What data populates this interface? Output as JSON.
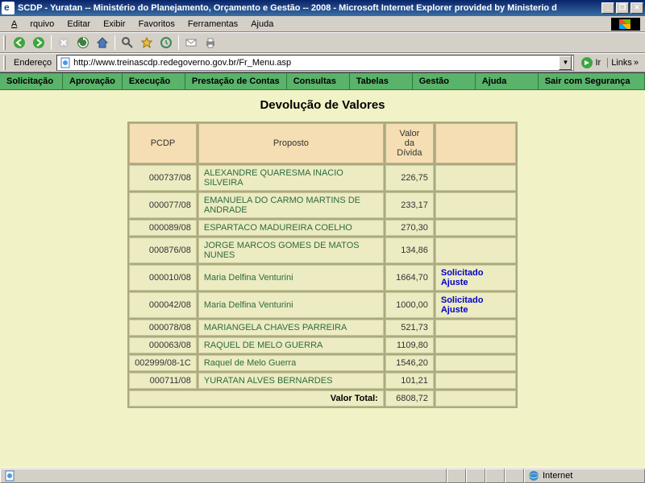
{
  "window": {
    "title": "SCDP - Yuratan -- Ministério do Planejamento, Orçamento e Gestão -- 2008 - Microsoft Internet Explorer provided by Ministerio d"
  },
  "menus": {
    "file": "Arquivo",
    "edit": "Editar",
    "view": "Exibir",
    "favorites": "Favoritos",
    "tools": "Ferramentas",
    "help": "Ajuda"
  },
  "address": {
    "label": "Endereço",
    "url": "http://www.treinascdp.redegoverno.gov.br/Fr_Menu.asp",
    "go": "Ir",
    "links": "Links"
  },
  "nav": {
    "solicitacao": "Solicitação",
    "aprovacao": "Aprovação",
    "execucao": "Execução",
    "prestacao": "Prestação de Contas",
    "consultas": "Consultas",
    "tabelas": "Tabelas",
    "gestao": "Gestão",
    "ajuda": "Ajuda",
    "sair": "Sair com Segurança"
  },
  "page": {
    "title": "Devolução de Valores",
    "headers": {
      "pcdp": "PCDP",
      "proposto": "Proposto",
      "valor": "Valor da Dívida"
    },
    "total_label": "Valor Total:",
    "total_value": "6808,72",
    "rows": [
      {
        "pcdp": "000737/08",
        "proposto": "ALEXANDRE QUARESMA INACIO SILVEIRA",
        "valor": "226,75",
        "status": ""
      },
      {
        "pcdp": "000077/08",
        "proposto": "EMANUELA DO CARMO MARTINS DE ANDRADE",
        "valor": "233,17",
        "status": ""
      },
      {
        "pcdp": "000089/08",
        "proposto": "ESPARTACO MADUREIRA COELHO",
        "valor": "270,30",
        "status": ""
      },
      {
        "pcdp": "000876/08",
        "proposto": "JORGE MARCOS GOMES DE MATOS NUNES",
        "valor": "134,86",
        "status": ""
      },
      {
        "pcdp": "000010/08",
        "proposto": "Maria Delfina Venturini",
        "valor": "1664,70",
        "status": "Solicitado Ajuste"
      },
      {
        "pcdp": "000042/08",
        "proposto": "Maria Delfina Venturini",
        "valor": "1000,00",
        "status": "Solicitado Ajuste"
      },
      {
        "pcdp": "000078/08",
        "proposto": "MARIANGELA CHAVES PARREIRA",
        "valor": "521,73",
        "status": ""
      },
      {
        "pcdp": "000063/08",
        "proposto": "RAQUEL DE MELO GUERRA",
        "valor": "1109,80",
        "status": ""
      },
      {
        "pcdp": "002999/08-1C",
        "proposto": "Raquel de Melo Guerra",
        "valor": "1546,20",
        "status": ""
      },
      {
        "pcdp": "000711/08",
        "proposto": "YURATAN ALVES BERNARDES",
        "valor": "101,21",
        "status": ""
      }
    ]
  },
  "status": {
    "zone": "Internet"
  }
}
